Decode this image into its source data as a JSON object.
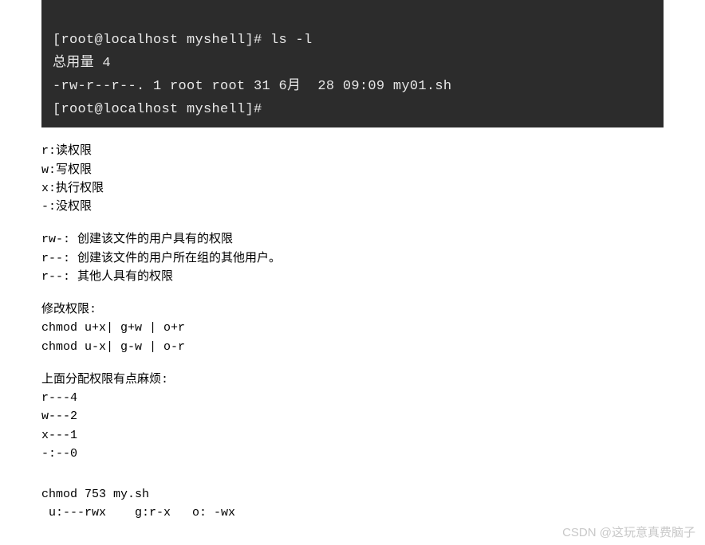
{
  "terminal": {
    "line1": "[root@localhost myshell]# ls -l",
    "line2": "总用量 4",
    "line3": "-rw-r--r--. 1 root root 31 6月  28 09:09 my01.sh",
    "line4": "[root@localhost myshell]#"
  },
  "perm_basics": {
    "r": "r:读权限",
    "w": "w:写权限",
    "x": "x:执行权限",
    "dash": "-:没权限"
  },
  "perm_groups": {
    "rw": "rw-: 创建该文件的用户具有的权限",
    "r1": "r--: 创建该文件的用户所在组的其他用户。",
    "r2": "r--: 其他人具有的权限"
  },
  "modify": {
    "title": "修改权限:",
    "line1": "chmod u+x| g+w | o+r",
    "line2": "chmod u-x| g-w | o-r"
  },
  "numeric": {
    "title": "上面分配权限有点麻烦:",
    "r": "r---4",
    "w": "w---2",
    "x": "x---1",
    "dash": "-:--0"
  },
  "example": {
    "cmd": "chmod 753 my.sh",
    "explain": " u:---rwx    g:r-x   o: -wx"
  },
  "watermark": "CSDN @这玩意真费脑子"
}
